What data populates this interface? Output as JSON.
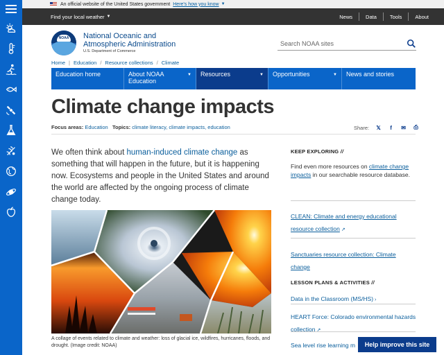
{
  "gov_banner": {
    "text": "An official website of the United States government",
    "link": "Here's how you know"
  },
  "topbar": {
    "local": "Find your local weather",
    "links": [
      "News",
      "Data",
      "Tools",
      "About"
    ]
  },
  "org": {
    "logo_text": "NOAA",
    "name_line1": "National Oceanic and",
    "name_line2": "Atmospheric Administration",
    "department": "U.S. Department of Commerce"
  },
  "search": {
    "placeholder": "Search NOAA sites"
  },
  "breadcrumb": [
    "Home",
    "Education",
    "Resource collections",
    "Climate"
  ],
  "nav": [
    {
      "label": "Education home",
      "dropdown": false,
      "active": false
    },
    {
      "label": "About NOAA Education",
      "dropdown": true,
      "active": false
    },
    {
      "label": "Resources",
      "dropdown": true,
      "active": true
    },
    {
      "label": "Opportunities",
      "dropdown": true,
      "active": false
    },
    {
      "label": "News and stories",
      "dropdown": false,
      "active": false
    }
  ],
  "page": {
    "title": "Climate change impacts",
    "focus_label": "Focus areas:",
    "focus_value": "Education",
    "topics_label": "Topics:",
    "topics": "climate literacy, climate impacts, education",
    "share_label": "Share:",
    "intro_pre": "We often think about ",
    "intro_link": "human-induced climate change",
    "intro_post": " as something that will happen in the future, but it is happening now. Ecosystems and people in the United States and around the world are affected by the ongoing process of climate change today.",
    "caption": "A collage of events related to climate and weather: loss of glacial ice, wildfires, hurricanes, floods, and drought. (Image credit: NOAA)"
  },
  "sidebar": {
    "icons": [
      "weather-icon",
      "climate-icon",
      "ocean-coasts-icon",
      "marine-life-icon",
      "satellites-icon",
      "science-icon",
      "biology-icon",
      "global-icon",
      "planet-icon",
      "health-icon"
    ]
  },
  "right": {
    "explore_head": "KEEP EXPLORING",
    "explore_pre": "Find even more resources on ",
    "explore_link": "climate change impacts",
    "explore_post": " in our searchable resource database.",
    "clean_link": "CLEAN: Climate and energy educational resource collection",
    "sanct_link": "Sanctuaries resource collection: Climate change",
    "lessons_head": "LESSON PLANS & ACTIVITIES",
    "lessons": [
      "Data in the Classroom (MS/HS)",
      "HEART Force: Colorado environmental hazards collection",
      "Sea level rise learning m"
    ]
  },
  "help_button": "Help improve this site",
  "colors": {
    "primary_blue": "#0a65c9",
    "dark_blue": "#0b3c8c",
    "topbar": "#333333",
    "link": "#0a5e9c"
  }
}
